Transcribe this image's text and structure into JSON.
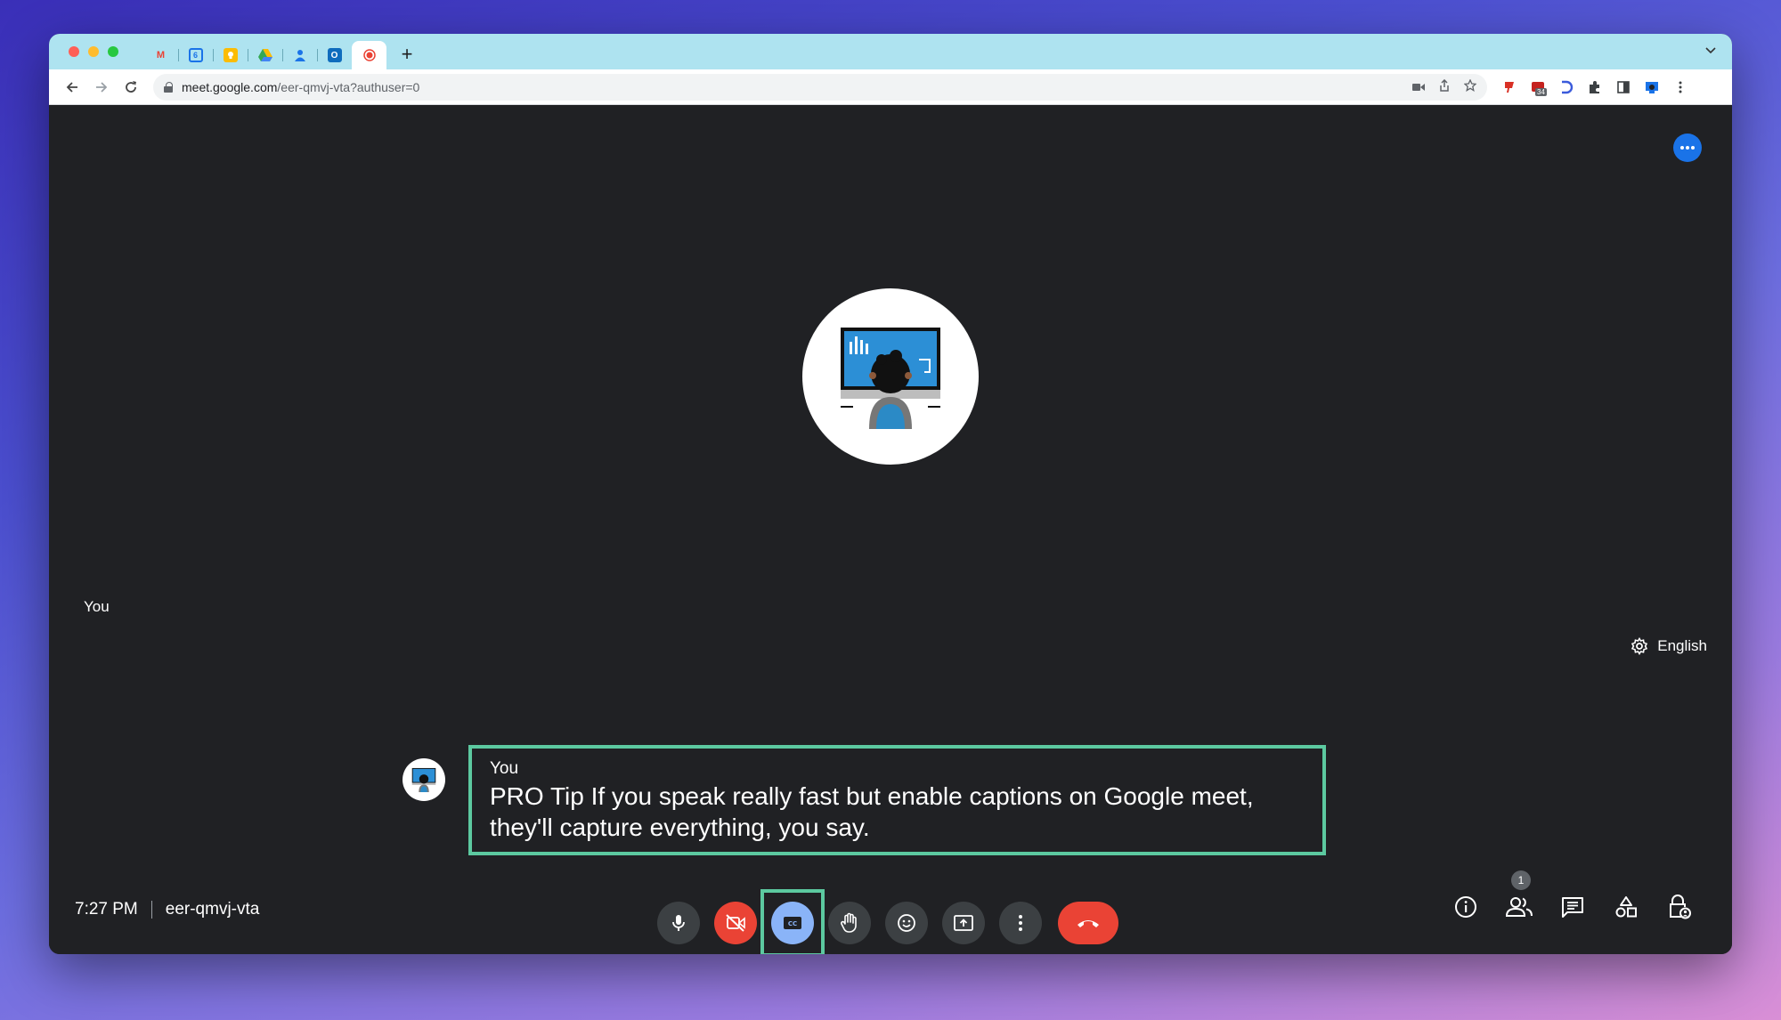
{
  "browser": {
    "tabs": [
      {
        "icon": "gmail-icon",
        "letter": "M",
        "color": "#ea4335"
      },
      {
        "icon": "calendar-icon",
        "letter": "6",
        "color": "#1a73e8"
      },
      {
        "icon": "keep-icon",
        "letter": "",
        "color": "#fbbc04"
      },
      {
        "icon": "drive-icon",
        "letter": "",
        "color": "#34a853"
      },
      {
        "icon": "contacts-icon",
        "letter": "",
        "color": "#1a73e8"
      },
      {
        "icon": "outlook-icon",
        "letter": "",
        "color": "#0f6cbd"
      },
      {
        "icon": "meet-recording-icon",
        "letter": "",
        "color": "#ea4335",
        "active": true
      }
    ],
    "url_host": "meet.google.com",
    "url_path": "/eer-qmvj-vta?authuser=0",
    "extension_badge": "34"
  },
  "meet": {
    "self_label": "You",
    "caption_language": "English",
    "caption": {
      "speaker": "You",
      "text": "PRO Tip If you speak really fast but enable captions on Google meet, they'll capture everything, you say."
    },
    "time": "7:27 PM",
    "meeting_code": "eer-qmvj-vta",
    "participant_count": "1"
  },
  "colors": {
    "meet_bg": "#202124",
    "button_bg": "#3c4043",
    "danger": "#ea4335",
    "cc_active": "#8ab4f8",
    "highlight": "#5cc9a0",
    "accent": "#1a73e8"
  }
}
